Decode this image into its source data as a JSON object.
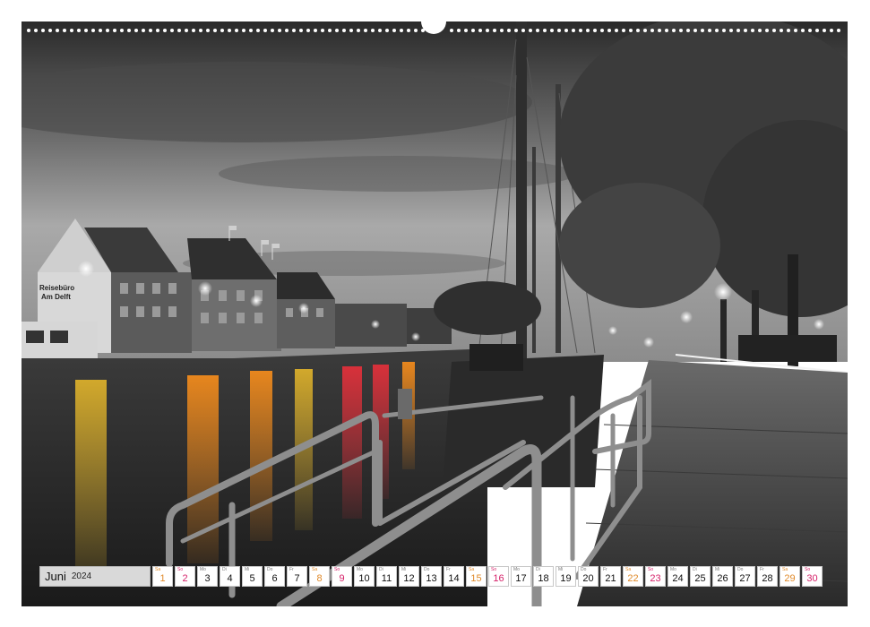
{
  "calendar": {
    "month": "Juni",
    "year": "2024",
    "days": [
      {
        "dow": "Sa",
        "num": "1",
        "type": "sat"
      },
      {
        "dow": "So",
        "num": "2",
        "type": "sun"
      },
      {
        "dow": "Mo",
        "num": "3",
        "type": "weekday"
      },
      {
        "dow": "Di",
        "num": "4",
        "type": "weekday"
      },
      {
        "dow": "Mi",
        "num": "5",
        "type": "weekday"
      },
      {
        "dow": "Do",
        "num": "6",
        "type": "weekday"
      },
      {
        "dow": "Fr",
        "num": "7",
        "type": "weekday"
      },
      {
        "dow": "Sa",
        "num": "8",
        "type": "sat"
      },
      {
        "dow": "So",
        "num": "9",
        "type": "sun"
      },
      {
        "dow": "Mo",
        "num": "10",
        "type": "weekday"
      },
      {
        "dow": "Di",
        "num": "11",
        "type": "weekday"
      },
      {
        "dow": "Mi",
        "num": "12",
        "type": "weekday"
      },
      {
        "dow": "Do",
        "num": "13",
        "type": "weekday"
      },
      {
        "dow": "Fr",
        "num": "14",
        "type": "weekday"
      },
      {
        "dow": "Sa",
        "num": "15",
        "type": "sat"
      },
      {
        "dow": "So",
        "num": "16",
        "type": "sun"
      },
      {
        "dow": "Mo",
        "num": "17",
        "type": "weekday"
      },
      {
        "dow": "Di",
        "num": "18",
        "type": "weekday"
      },
      {
        "dow": "Mi",
        "num": "19",
        "type": "weekday"
      },
      {
        "dow": "Do",
        "num": "20",
        "type": "weekday"
      },
      {
        "dow": "Fr",
        "num": "21",
        "type": "weekday"
      },
      {
        "dow": "Sa",
        "num": "22",
        "type": "sat"
      },
      {
        "dow": "So",
        "num": "23",
        "type": "sun"
      },
      {
        "dow": "Mo",
        "num": "24",
        "type": "weekday"
      },
      {
        "dow": "Di",
        "num": "25",
        "type": "weekday"
      },
      {
        "dow": "Mi",
        "num": "26",
        "type": "weekday"
      },
      {
        "dow": "Do",
        "num": "27",
        "type": "weekday"
      },
      {
        "dow": "Fr",
        "num": "28",
        "type": "weekday"
      },
      {
        "dow": "Sa",
        "num": "29",
        "type": "sat"
      },
      {
        "dow": "So",
        "num": "30",
        "type": "sun"
      }
    ]
  },
  "photo": {
    "sign_line1": "Reisebüro",
    "sign_line2": "Am Delft"
  },
  "colors": {
    "saturday": "#e08a2a",
    "sunday": "#d6226a",
    "reflection_yellow": "#e3b52a",
    "reflection_orange": "#f08a1c",
    "reflection_red": "#e0303a"
  }
}
